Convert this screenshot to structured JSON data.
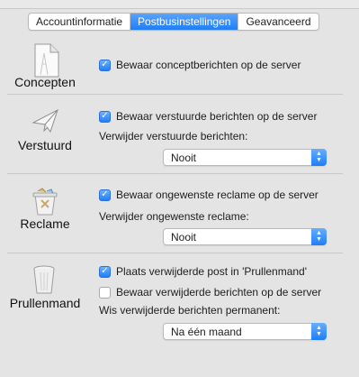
{
  "tabs": [
    {
      "label": "Accountinformatie",
      "active": false
    },
    {
      "label": "Postbusinstellingen",
      "active": true
    },
    {
      "label": "Geavanceerd",
      "active": false
    }
  ],
  "sections": {
    "concepten": {
      "label": "Concepten",
      "icon": "document-icon",
      "checkbox": {
        "label": "Bewaar conceptberichten op de server",
        "checked": true
      }
    },
    "verstuurd": {
      "label": "Verstuurd",
      "icon": "paper-plane-icon",
      "checkbox": {
        "label": "Bewaar verstuurde berichten op de server",
        "checked": true
      },
      "remove_label": "Verwijder verstuurde berichten:",
      "select_value": "Nooit"
    },
    "reclame": {
      "label": "Reclame",
      "icon": "junk-bin-icon",
      "checkbox": {
        "label": "Bewaar ongewenste reclame op de server",
        "checked": true
      },
      "remove_label": "Verwijder ongewenste reclame:",
      "select_value": "Nooit"
    },
    "prullenmand": {
      "label": "Prullenmand",
      "icon": "trash-can-icon",
      "checkbox1": {
        "label": "Plaats verwijderde post in 'Prullenmand'",
        "checked": true
      },
      "checkbox2": {
        "label": "Bewaar verwijderde berichten op de server",
        "checked": false
      },
      "remove_label": "Wis verwijderde berichten permanent:",
      "select_value": "Na één maand"
    }
  },
  "colors": {
    "accent": "#1f7ef6",
    "background": "#e4e4e4"
  }
}
